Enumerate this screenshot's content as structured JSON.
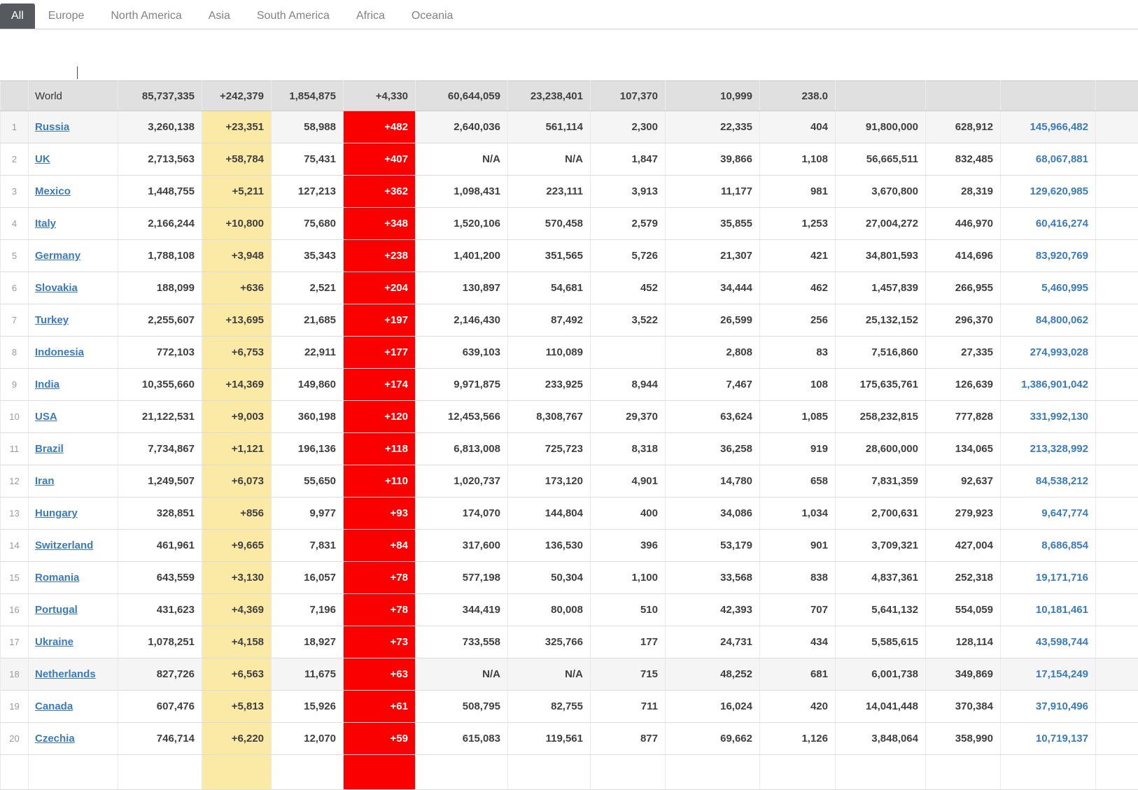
{
  "tabs": [
    {
      "label": "All",
      "active": true
    },
    {
      "label": "Europe",
      "active": false
    },
    {
      "label": "North America",
      "active": false
    },
    {
      "label": "Asia",
      "active": false
    },
    {
      "label": "South America",
      "active": false
    },
    {
      "label": "Africa",
      "active": false
    },
    {
      "label": "Oceania",
      "active": false
    }
  ],
  "colors": {
    "new_cases_yellow": "#fbe9a6",
    "new_deaths_red": "#fb0000",
    "link_blue": "#3b7bbb",
    "active_tab_gray": "#565a5e",
    "world_row_gray": "#e0e0e0",
    "stripe_gray": "#f5f5f5"
  },
  "table": {
    "world": {
      "label": "World",
      "total_cases": "85,737,335",
      "new_cases": "+242,379",
      "total_deaths": "1,854,875",
      "new_deaths": "+4,330",
      "total_recovered": "60,644,059",
      "active_cases": "23,238,401",
      "serious_critical": "107,370",
      "cases_per_1m": "10,999",
      "deaths_per_1m": "238.0",
      "total_tests": "",
      "tests_per_1m": "",
      "population": ""
    },
    "rows": [
      {
        "rank": "1",
        "country": "Russia",
        "highlight": true,
        "total_cases": "3,260,138",
        "new_cases": "+23,351",
        "total_deaths": "58,988",
        "new_deaths": "+482",
        "total_recovered": "2,640,036",
        "active_cases": "561,114",
        "serious_critical": "2,300",
        "cases_per_1m": "22,335",
        "deaths_per_1m": "404",
        "total_tests": "91,800,000",
        "tests_per_1m": "628,912",
        "population": "145,966,482"
      },
      {
        "rank": "2",
        "country": "UK",
        "highlight": false,
        "total_cases": "2,713,563",
        "new_cases": "+58,784",
        "total_deaths": "75,431",
        "new_deaths": "+407",
        "total_recovered": "N/A",
        "active_cases": "N/A",
        "serious_critical": "1,847",
        "cases_per_1m": "39,866",
        "deaths_per_1m": "1,108",
        "total_tests": "56,665,511",
        "tests_per_1m": "832,485",
        "population": "68,067,881"
      },
      {
        "rank": "3",
        "country": "Mexico",
        "highlight": false,
        "total_cases": "1,448,755",
        "new_cases": "+5,211",
        "total_deaths": "127,213",
        "new_deaths": "+362",
        "total_recovered": "1,098,431",
        "active_cases": "223,111",
        "serious_critical": "3,913",
        "cases_per_1m": "11,177",
        "deaths_per_1m": "981",
        "total_tests": "3,670,800",
        "tests_per_1m": "28,319",
        "population": "129,620,985"
      },
      {
        "rank": "4",
        "country": "Italy",
        "highlight": false,
        "total_cases": "2,166,244",
        "new_cases": "+10,800",
        "total_deaths": "75,680",
        "new_deaths": "+348",
        "total_recovered": "1,520,106",
        "active_cases": "570,458",
        "serious_critical": "2,579",
        "cases_per_1m": "35,855",
        "deaths_per_1m": "1,253",
        "total_tests": "27,004,272",
        "tests_per_1m": "446,970",
        "population": "60,416,274"
      },
      {
        "rank": "5",
        "country": "Germany",
        "highlight": false,
        "total_cases": "1,788,108",
        "new_cases": "+3,948",
        "total_deaths": "35,343",
        "new_deaths": "+238",
        "total_recovered": "1,401,200",
        "active_cases": "351,565",
        "serious_critical": "5,726",
        "cases_per_1m": "21,307",
        "deaths_per_1m": "421",
        "total_tests": "34,801,593",
        "tests_per_1m": "414,696",
        "population": "83,920,769"
      },
      {
        "rank": "6",
        "country": "Slovakia",
        "highlight": false,
        "total_cases": "188,099",
        "new_cases": "+636",
        "total_deaths": "2,521",
        "new_deaths": "+204",
        "total_recovered": "130,897",
        "active_cases": "54,681",
        "serious_critical": "452",
        "cases_per_1m": "34,444",
        "deaths_per_1m": "462",
        "total_tests": "1,457,839",
        "tests_per_1m": "266,955",
        "population": "5,460,995"
      },
      {
        "rank": "7",
        "country": "Turkey",
        "highlight": false,
        "total_cases": "2,255,607",
        "new_cases": "+13,695",
        "total_deaths": "21,685",
        "new_deaths": "+197",
        "total_recovered": "2,146,430",
        "active_cases": "87,492",
        "serious_critical": "3,522",
        "cases_per_1m": "26,599",
        "deaths_per_1m": "256",
        "total_tests": "25,132,152",
        "tests_per_1m": "296,370",
        "population": "84,800,062"
      },
      {
        "rank": "8",
        "country": "Indonesia",
        "highlight": false,
        "total_cases": "772,103",
        "new_cases": "+6,753",
        "total_deaths": "22,911",
        "new_deaths": "+177",
        "total_recovered": "639,103",
        "active_cases": "110,089",
        "serious_critical": "",
        "cases_per_1m": "2,808",
        "deaths_per_1m": "83",
        "total_tests": "7,516,860",
        "tests_per_1m": "27,335",
        "population": "274,993,028"
      },
      {
        "rank": "9",
        "country": "India",
        "highlight": false,
        "total_cases": "10,355,660",
        "new_cases": "+14,369",
        "total_deaths": "149,860",
        "new_deaths": "+174",
        "total_recovered": "9,971,875",
        "active_cases": "233,925",
        "serious_critical": "8,944",
        "cases_per_1m": "7,467",
        "deaths_per_1m": "108",
        "total_tests": "175,635,761",
        "tests_per_1m": "126,639",
        "population": "1,386,901,042"
      },
      {
        "rank": "10",
        "country": "USA",
        "highlight": false,
        "total_cases": "21,122,531",
        "new_cases": "+9,003",
        "total_deaths": "360,198",
        "new_deaths": "+120",
        "total_recovered": "12,453,566",
        "active_cases": "8,308,767",
        "serious_critical": "29,370",
        "cases_per_1m": "63,624",
        "deaths_per_1m": "1,085",
        "total_tests": "258,232,815",
        "tests_per_1m": "777,828",
        "population": "331,992,130"
      },
      {
        "rank": "11",
        "country": "Brazil",
        "highlight": false,
        "total_cases": "7,734,867",
        "new_cases": "+1,121",
        "total_deaths": "196,136",
        "new_deaths": "+118",
        "total_recovered": "6,813,008",
        "active_cases": "725,723",
        "serious_critical": "8,318",
        "cases_per_1m": "36,258",
        "deaths_per_1m": "919",
        "total_tests": "28,600,000",
        "tests_per_1m": "134,065",
        "population": "213,328,992"
      },
      {
        "rank": "12",
        "country": "Iran",
        "highlight": false,
        "total_cases": "1,249,507",
        "new_cases": "+6,073",
        "total_deaths": "55,650",
        "new_deaths": "+110",
        "total_recovered": "1,020,737",
        "active_cases": "173,120",
        "serious_critical": "4,901",
        "cases_per_1m": "14,780",
        "deaths_per_1m": "658",
        "total_tests": "7,831,359",
        "tests_per_1m": "92,637",
        "population": "84,538,212"
      },
      {
        "rank": "13",
        "country": "Hungary",
        "highlight": false,
        "total_cases": "328,851",
        "new_cases": "+856",
        "total_deaths": "9,977",
        "new_deaths": "+93",
        "total_recovered": "174,070",
        "active_cases": "144,804",
        "serious_critical": "400",
        "cases_per_1m": "34,086",
        "deaths_per_1m": "1,034",
        "total_tests": "2,700,631",
        "tests_per_1m": "279,923",
        "population": "9,647,774"
      },
      {
        "rank": "14",
        "country": "Switzerland",
        "highlight": false,
        "total_cases": "461,961",
        "new_cases": "+9,665",
        "total_deaths": "7,831",
        "new_deaths": "+84",
        "total_recovered": "317,600",
        "active_cases": "136,530",
        "serious_critical": "396",
        "cases_per_1m": "53,179",
        "deaths_per_1m": "901",
        "total_tests": "3,709,321",
        "tests_per_1m": "427,004",
        "population": "8,686,854"
      },
      {
        "rank": "15",
        "country": "Romania",
        "highlight": false,
        "total_cases": "643,559",
        "new_cases": "+3,130",
        "total_deaths": "16,057",
        "new_deaths": "+78",
        "total_recovered": "577,198",
        "active_cases": "50,304",
        "serious_critical": "1,100",
        "cases_per_1m": "33,568",
        "deaths_per_1m": "838",
        "total_tests": "4,837,361",
        "tests_per_1m": "252,318",
        "population": "19,171,716"
      },
      {
        "rank": "16",
        "country": "Portugal",
        "highlight": false,
        "total_cases": "431,623",
        "new_cases": "+4,369",
        "total_deaths": "7,196",
        "new_deaths": "+78",
        "total_recovered": "344,419",
        "active_cases": "80,008",
        "serious_critical": "510",
        "cases_per_1m": "42,393",
        "deaths_per_1m": "707",
        "total_tests": "5,641,132",
        "tests_per_1m": "554,059",
        "population": "10,181,461"
      },
      {
        "rank": "17",
        "country": "Ukraine",
        "highlight": false,
        "total_cases": "1,078,251",
        "new_cases": "+4,158",
        "total_deaths": "18,927",
        "new_deaths": "+73",
        "total_recovered": "733,558",
        "active_cases": "325,766",
        "serious_critical": "177",
        "cases_per_1m": "24,731",
        "deaths_per_1m": "434",
        "total_tests": "5,585,615",
        "tests_per_1m": "128,114",
        "population": "43,598,744"
      },
      {
        "rank": "18",
        "country": "Netherlands",
        "highlight": true,
        "total_cases": "827,726",
        "new_cases": "+6,563",
        "total_deaths": "11,675",
        "new_deaths": "+63",
        "total_recovered": "N/A",
        "active_cases": "N/A",
        "serious_critical": "715",
        "cases_per_1m": "48,252",
        "deaths_per_1m": "681",
        "total_tests": "6,001,738",
        "tests_per_1m": "349,869",
        "population": "17,154,249"
      },
      {
        "rank": "19",
        "country": "Canada",
        "highlight": false,
        "total_cases": "607,476",
        "new_cases": "+5,813",
        "total_deaths": "15,926",
        "new_deaths": "+61",
        "total_recovered": "508,795",
        "active_cases": "82,755",
        "serious_critical": "711",
        "cases_per_1m": "16,024",
        "deaths_per_1m": "420",
        "total_tests": "14,041,448",
        "tests_per_1m": "370,384",
        "population": "37,910,496"
      },
      {
        "rank": "20",
        "country": "Czechia",
        "highlight": false,
        "total_cases": "746,714",
        "new_cases": "+6,220",
        "total_deaths": "12,070",
        "new_deaths": "+59",
        "total_recovered": "615,083",
        "active_cases": "119,561",
        "serious_critical": "877",
        "cases_per_1m": "69,662",
        "deaths_per_1m": "1,126",
        "total_tests": "3,848,064",
        "tests_per_1m": "358,990",
        "population": "10,719,137"
      }
    ]
  }
}
